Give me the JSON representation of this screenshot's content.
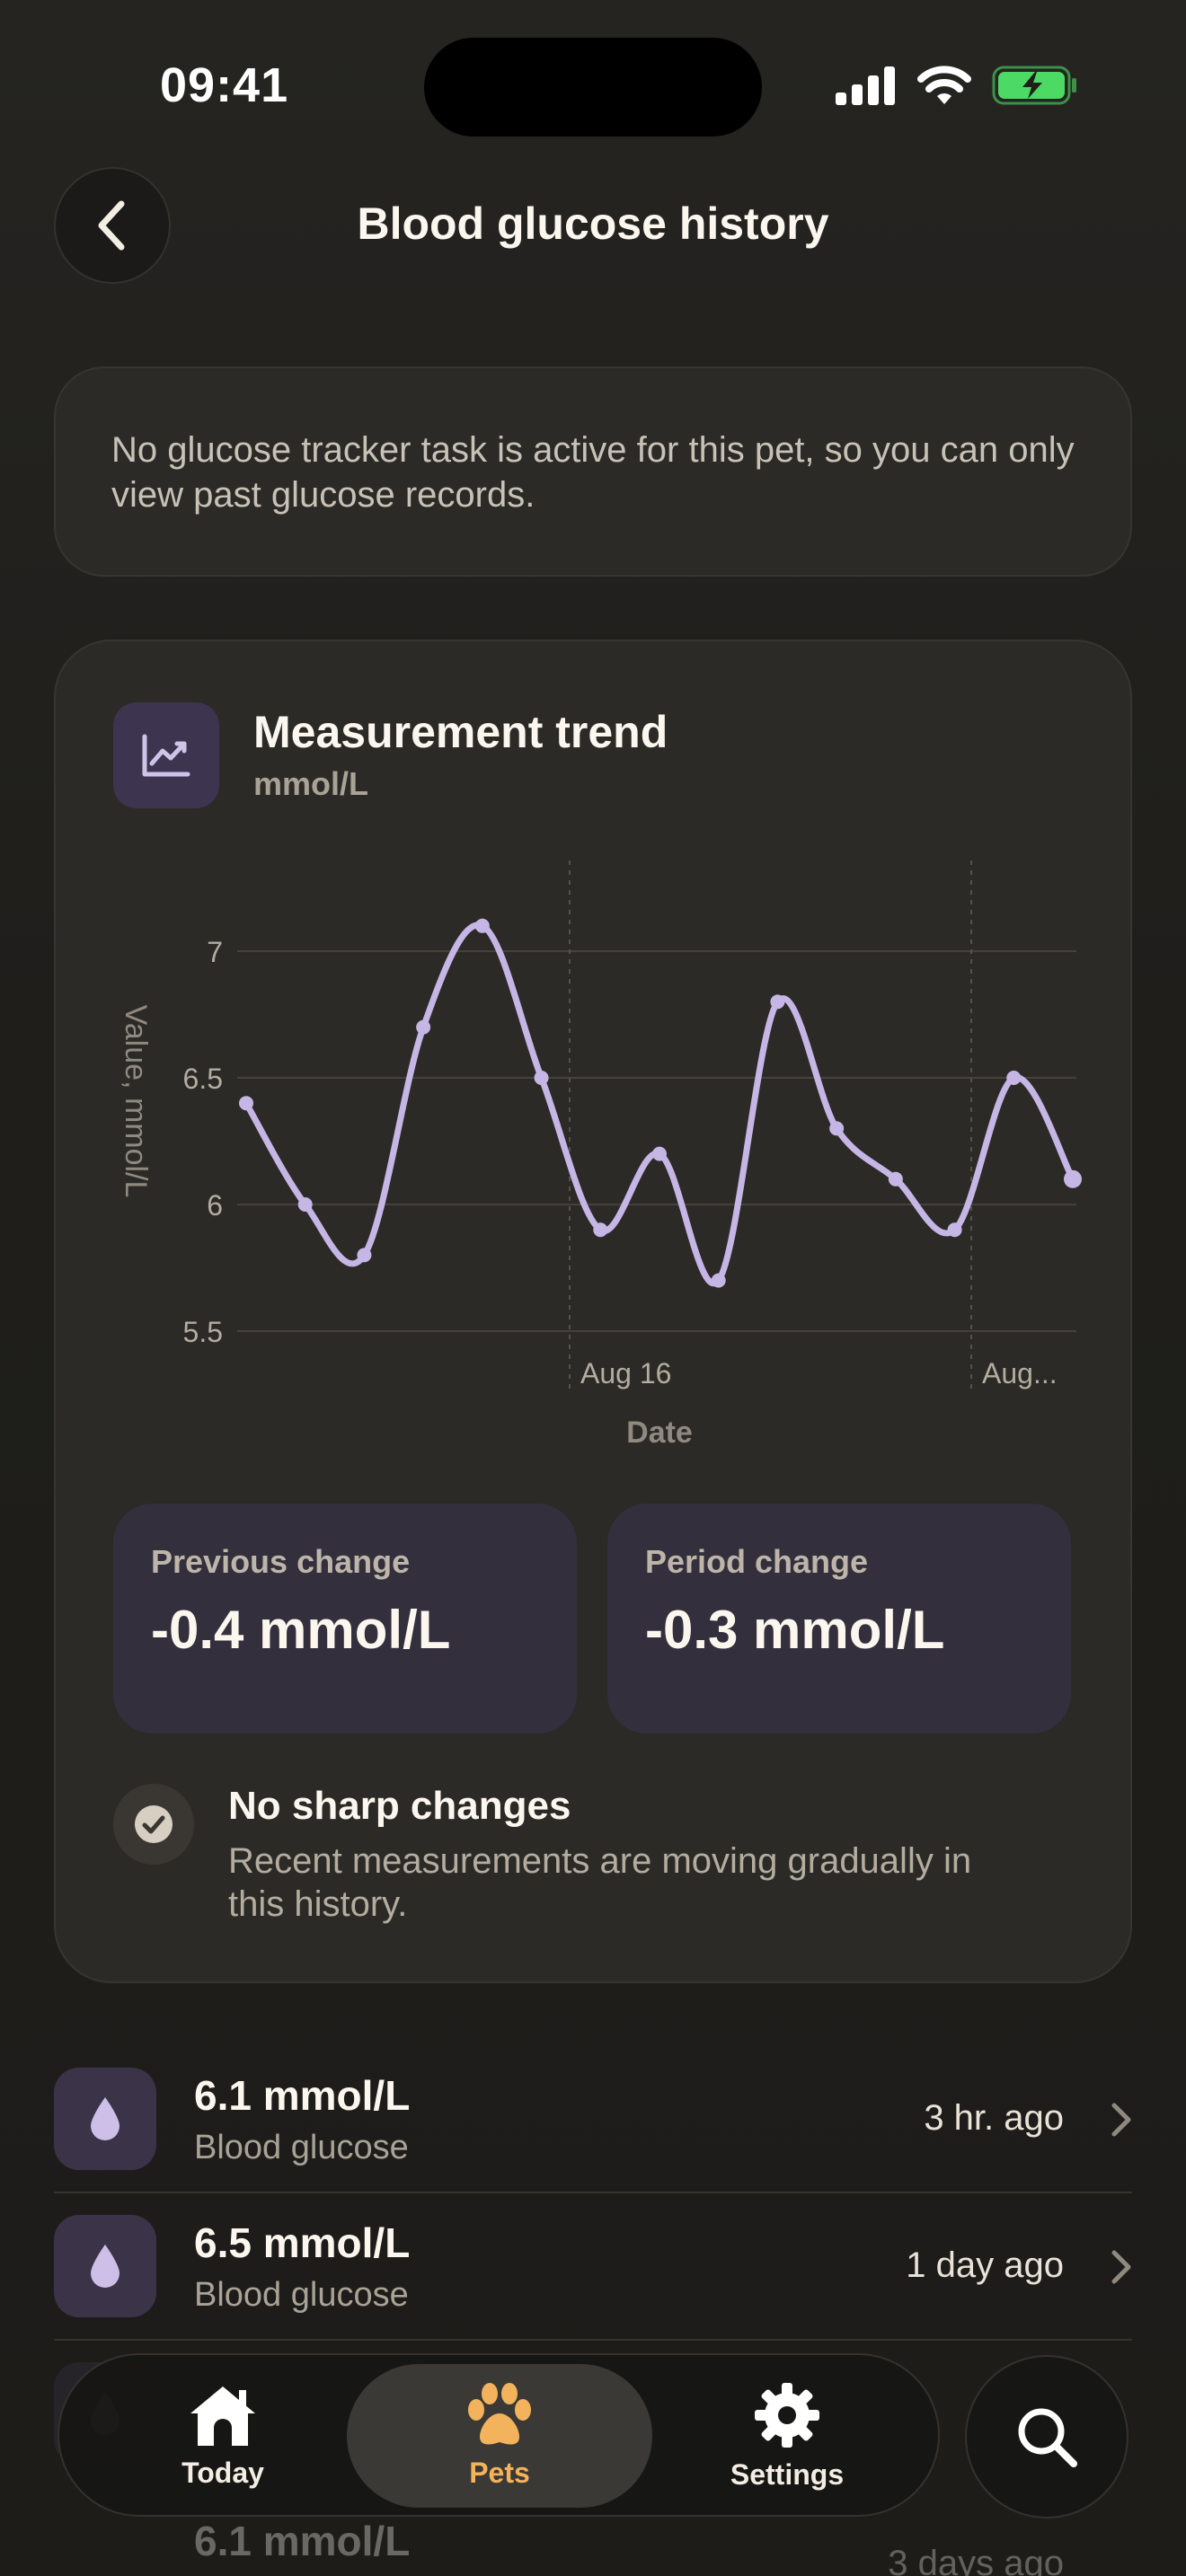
{
  "status_bar": {
    "time": "09:41"
  },
  "header": {
    "title": "Blood glucose history"
  },
  "info_card": {
    "text": "No glucose tracker task is active for this pet, so you can only view past glucose records."
  },
  "trend": {
    "title": "Measurement trend",
    "unit": "mmol/L",
    "previous_change": {
      "label": "Previous change",
      "value": "-0.4 mmol/L"
    },
    "period_change": {
      "label": "Period change",
      "value": "-0.3 mmol/L"
    },
    "assessment": {
      "title": "No sharp changes",
      "description": "Recent measurements are moving gradually in this history."
    }
  },
  "chart_data": {
    "type": "line",
    "ylabel": "Value, mmol/L",
    "xlabel": "Date",
    "ylim": [
      5.5,
      7.2
    ],
    "yticks": [
      "7",
      "6.5",
      "6",
      "5.5"
    ],
    "xticks": [
      "Aug 16",
      "Aug..."
    ],
    "series": [
      {
        "values": [
          6.4,
          6.0,
          5.8,
          6.7,
          7.1,
          6.5,
          5.9,
          6.2,
          5.7,
          6.8,
          6.3,
          6.1,
          5.9,
          6.5,
          6.1
        ]
      }
    ],
    "line_color": "#c6b6e6",
    "grid": true
  },
  "records": [
    {
      "value": "6.1 mmol/L",
      "type": "Blood glucose",
      "time": "3 hr. ago"
    },
    {
      "value": "6.5 mmol/L",
      "type": "Blood glucose",
      "time": "1 day ago"
    },
    {
      "value": "6.1 mmol/L",
      "time": "3 days ago"
    }
  ],
  "tab_bar": {
    "tabs": [
      {
        "label": "Today",
        "icon": "house-icon"
      },
      {
        "label": "Pets",
        "icon": "paw-icon",
        "active": true
      },
      {
        "label": "Settings",
        "icon": "gear-icon"
      }
    ],
    "search_icon": "search-icon"
  },
  "colors": {
    "accent": "#f2b35c",
    "chart_line": "#c6b6e6",
    "icon_tint": "#3d3550"
  }
}
